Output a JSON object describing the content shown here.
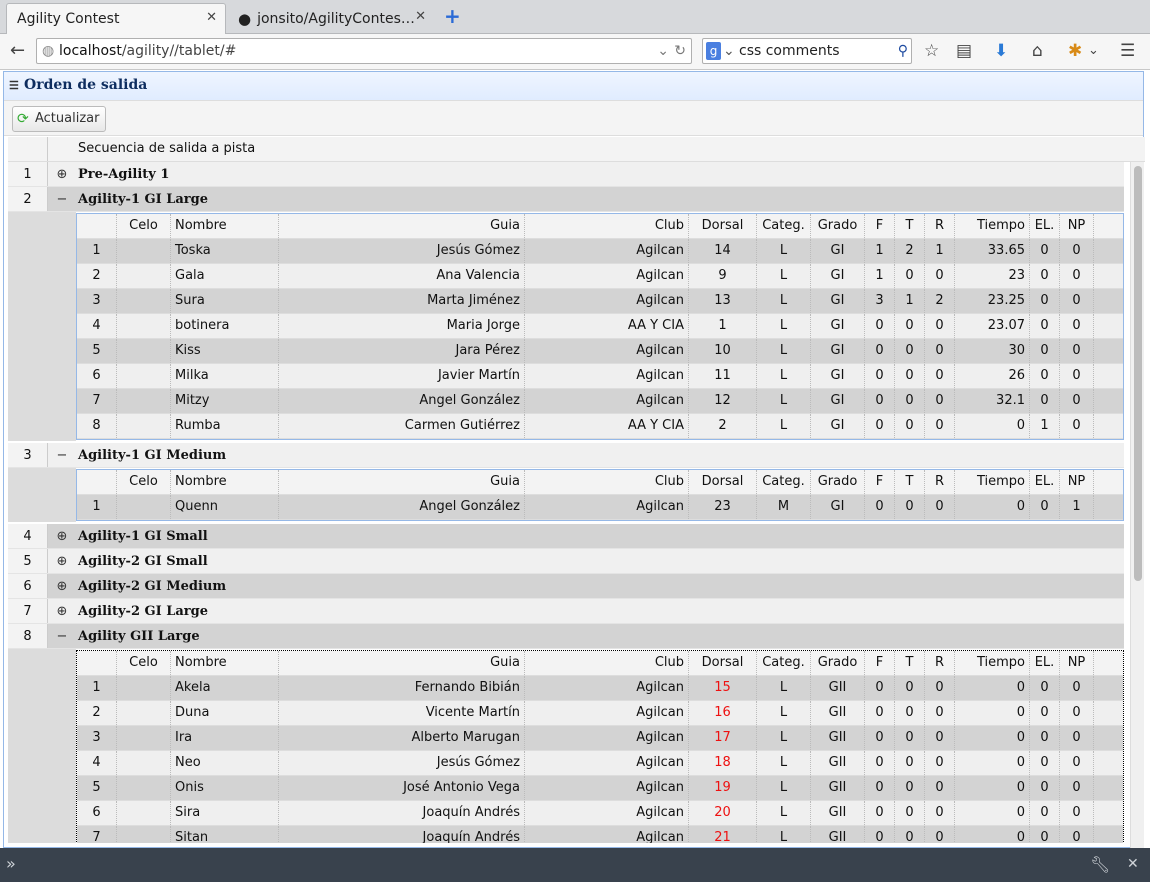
{
  "browser": {
    "tabs": [
      {
        "title": "Agility Contest",
        "active": true
      },
      {
        "title": "jonsito/AgilityContes…",
        "active": false
      }
    ],
    "new_tab": "+",
    "url_host": "localhost",
    "url_path": "/agility//tablet/#",
    "search_value": "css comments",
    "icons": [
      "back-icon",
      "globe-icon",
      "reload-icon",
      "google-icon",
      "search-icon",
      "star-icon",
      "reading-list-icon",
      "download-icon",
      "home-icon",
      "addon-icon",
      "menu-icon"
    ]
  },
  "panel": {
    "title": "Orden de salida",
    "refresh_label": "Actualizar"
  },
  "grid": {
    "header": "Secuencia de salida a pista",
    "columns": [
      "Celo",
      "Nombre",
      "Guia",
      "Club",
      "Dorsal",
      "Categ.",
      "Grado",
      "F",
      "T",
      "R",
      "Tiempo",
      "EL.",
      "NP"
    ],
    "groups": [
      {
        "n": "1",
        "name": "Pre-Agility 1",
        "expanded": false
      },
      {
        "n": "2",
        "name": "Agility-1 GI Large",
        "expanded": true,
        "rows": [
          [
            "1",
            "",
            "Toska",
            "Jesús Gómez",
            "Agilcan",
            "14",
            "L",
            "GI",
            "1",
            "2",
            "1",
            "33.65",
            "0",
            "0"
          ],
          [
            "2",
            "",
            "Gala",
            "Ana Valencia",
            "Agilcan",
            "9",
            "L",
            "GI",
            "1",
            "0",
            "0",
            "23",
            "0",
            "0"
          ],
          [
            "3",
            "",
            "Sura",
            "Marta Jiménez",
            "Agilcan",
            "13",
            "L",
            "GI",
            "3",
            "1",
            "2",
            "23.25",
            "0",
            "0"
          ],
          [
            "4",
            "",
            "botinera",
            "Maria Jorge",
            "AA Y CIA",
            "1",
            "L",
            "GI",
            "0",
            "0",
            "0",
            "23.07",
            "0",
            "0"
          ],
          [
            "5",
            "",
            "Kiss",
            "Jara Pérez",
            "Agilcan",
            "10",
            "L",
            "GI",
            "0",
            "0",
            "0",
            "30",
            "0",
            "0"
          ],
          [
            "6",
            "",
            "Milka",
            "Javier Martín",
            "Agilcan",
            "11",
            "L",
            "GI",
            "0",
            "0",
            "0",
            "26",
            "0",
            "0"
          ],
          [
            "7",
            "",
            "Mitzy",
            "Angel González",
            "Agilcan",
            "12",
            "L",
            "GI",
            "0",
            "0",
            "0",
            "32.1",
            "0",
            "0"
          ],
          [
            "8",
            "",
            "Rumba",
            "Carmen Gutiérrez",
            "AA Y CIA",
            "2",
            "L",
            "GI",
            "0",
            "0",
            "0",
            "0",
            "1",
            "0"
          ]
        ]
      },
      {
        "n": "3",
        "name": "Agility-1 GI Medium",
        "expanded": true,
        "rows": [
          [
            "1",
            "",
            "Quenn",
            "Angel González",
            "Agilcan",
            "23",
            "M",
            "GI",
            "0",
            "0",
            "0",
            "0",
            "0",
            "1"
          ]
        ]
      },
      {
        "n": "4",
        "name": "Agility-1 GI Small",
        "expanded": false
      },
      {
        "n": "5",
        "name": "Agility-2 GI Small",
        "expanded": false
      },
      {
        "n": "6",
        "name": "Agility-2 GI Medium",
        "expanded": false
      },
      {
        "n": "7",
        "name": "Agility-2 GI Large",
        "expanded": false
      },
      {
        "n": "8",
        "name": "Agility GII Large",
        "expanded": true,
        "rows": [
          [
            "1",
            "",
            "Akela",
            "Fernando Bibián",
            "Agilcan",
            "15",
            "L",
            "GII",
            "0",
            "0",
            "0",
            "0",
            "0",
            "0"
          ],
          [
            "2",
            "",
            "Duna",
            "Vicente Martín",
            "Agilcan",
            "16",
            "L",
            "GII",
            "0",
            "0",
            "0",
            "0",
            "0",
            "0"
          ],
          [
            "3",
            "",
            "Ira",
            "Alberto Marugan",
            "Agilcan",
            "17",
            "L",
            "GII",
            "0",
            "0",
            "0",
            "0",
            "0",
            "0"
          ],
          [
            "4",
            "",
            "Neo",
            "Jesús Gómez",
            "Agilcan",
            "18",
            "L",
            "GII",
            "0",
            "0",
            "0",
            "0",
            "0",
            "0"
          ],
          [
            "5",
            "",
            "Onis",
            "José Antonio Vega",
            "Agilcan",
            "19",
            "L",
            "GII",
            "0",
            "0",
            "0",
            "0",
            "0",
            "0"
          ],
          [
            "6",
            "",
            "Sira",
            "Joaquín Andrés",
            "Agilcan",
            "20",
            "L",
            "GII",
            "0",
            "0",
            "0",
            "0",
            "0",
            "0"
          ],
          [
            "7",
            "",
            "Sitan",
            "Joaquín Andrés",
            "Agilcan",
            "21",
            "L",
            "GII",
            "0",
            "0",
            "0",
            "0",
            "0",
            "0"
          ]
        ]
      }
    ]
  },
  "colors": {
    "accent": "#95b8e7",
    "title": "#0e2d5f",
    "alt_row": "#d3d3d3",
    "dorsal_highlight": "#e11111"
  }
}
